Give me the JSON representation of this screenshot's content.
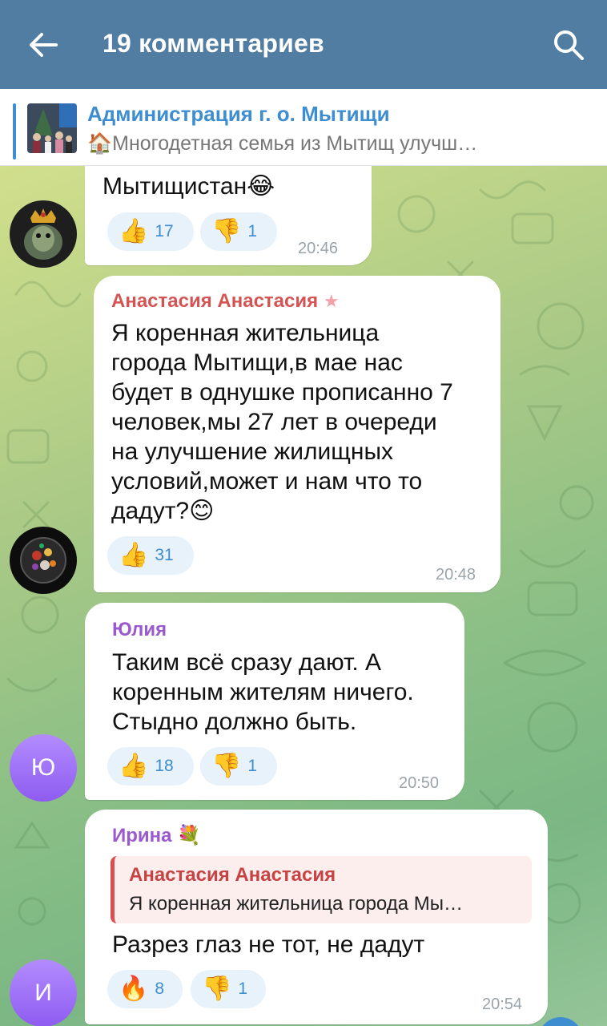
{
  "header": {
    "title": "19 комментариев"
  },
  "pinned": {
    "title": "Администрация г. о. Мытищи",
    "text": "🏠Многодетная семья из Мытищ улучш…"
  },
  "messages": [
    {
      "text": "Мытищистан😂",
      "reactions": [
        {
          "emoji": "👍",
          "count": "17"
        },
        {
          "emoji": "👎",
          "count": "1"
        }
      ],
      "time": "20:46"
    },
    {
      "author": "Анастасия Анастасия",
      "author_color": "#d45454",
      "lines": [
        "Я коренная жительница",
        "города Мытищи,в мае нас",
        "будет в однушке прописанно 7",
        "человек,мы 27 лет в очереди",
        "на улучшение жилищных",
        "условий,может и нам что то",
        "дадут?😊"
      ],
      "reactions": [
        {
          "emoji": "👍",
          "count": "31"
        }
      ],
      "time": "20:48"
    },
    {
      "author": "Юлия",
      "author_color": "#9b59d0",
      "avatar_letter": "Ю",
      "lines": [
        "Таким всё сразу дают. А",
        "коренным жителям ничего.",
        "Стыдно должно быть."
      ],
      "reactions": [
        {
          "emoji": "👍",
          "count": "18"
        },
        {
          "emoji": "👎",
          "count": "1"
        }
      ],
      "time": "20:50"
    },
    {
      "author": "Ирина",
      "author_color": "#9b59d0",
      "avatar_letter": "И",
      "reply": {
        "author": "Анастасия Анастасия",
        "text": "Я коренная жительница города Мы…"
      },
      "text": "Разрез глаз не тот, не дадут",
      "reactions": [
        {
          "emoji": "🔥",
          "count": "8"
        },
        {
          "emoji": "👎",
          "count": "1"
        }
      ],
      "time": "20:54"
    }
  ]
}
